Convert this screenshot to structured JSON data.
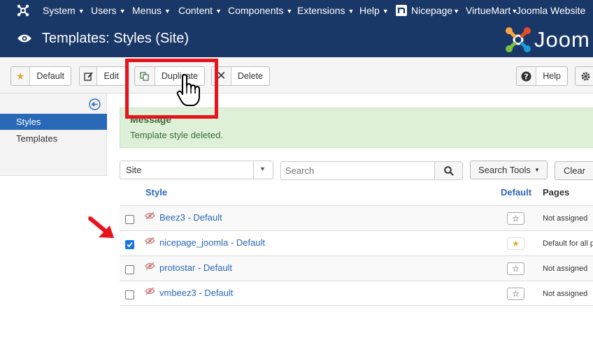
{
  "topbar": {
    "menus": [
      {
        "label": "System"
      },
      {
        "label": "Users"
      },
      {
        "label": "Menus"
      },
      {
        "label": "Content"
      },
      {
        "label": "Components"
      },
      {
        "label": "Extensions"
      },
      {
        "label": "Help"
      },
      {
        "label": "Nicepage"
      },
      {
        "label": "VirtueMart"
      }
    ],
    "site_label": "Joomla Website"
  },
  "header": {
    "title": "Templates: Styles (Site)",
    "brand": "Joom"
  },
  "toolbar": {
    "default_label": "Default",
    "edit_label": "Edit",
    "duplicate_label": "Duplicate",
    "delete_label": "Delete",
    "help_label": "Help"
  },
  "sidebar": {
    "items": [
      {
        "label": "Styles",
        "active": true
      },
      {
        "label": "Templates",
        "active": false
      }
    ]
  },
  "message": {
    "heading": "Message",
    "text": "Template style deleted."
  },
  "filters": {
    "client_value": "Site",
    "search_placeholder": "Search",
    "search_tools_label": "Search Tools",
    "clear_label": "Clear"
  },
  "table": {
    "headers": {
      "style": "Style",
      "default": "Default",
      "pages": "Pages"
    },
    "rows": [
      {
        "name": "Beez3 - Default",
        "checked": false,
        "is_default": false,
        "pages": "Not assigned"
      },
      {
        "name": "nicepage_joomla - Default",
        "checked": true,
        "is_default": true,
        "pages": "Default for all p"
      },
      {
        "name": "protostar - Default",
        "checked": false,
        "is_default": false,
        "pages": "Not assigned"
      },
      {
        "name": "vmbeez3 - Default",
        "checked": false,
        "is_default": false,
        "pages": "Not assigned"
      }
    ]
  },
  "colors": {
    "navbar": "#1a3867",
    "link": "#2a69b8",
    "sidebar_active": "#2a69b8",
    "message_bg": "#dff0d8",
    "highlight": "#e8141c",
    "star_default": "#e0a93a"
  }
}
